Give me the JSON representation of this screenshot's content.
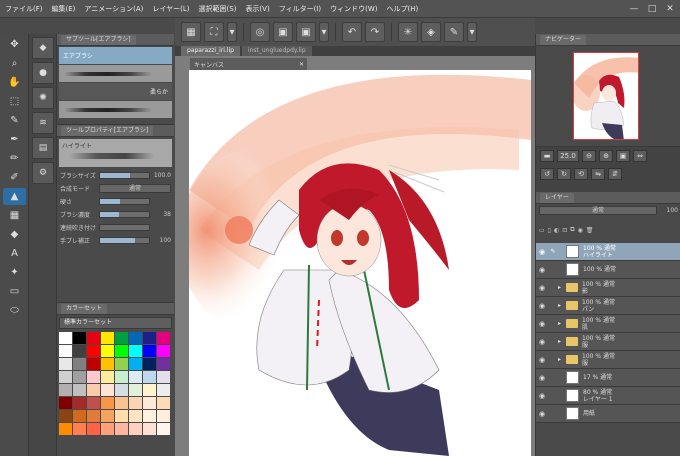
{
  "menu": [
    "ファイル(F)",
    "編集(E)",
    "アニメーション(A)",
    "レイヤー(L)",
    "選択範囲(S)",
    "表示(V)",
    "フィルター(I)",
    "ウィンドウ(W)",
    "ヘルプ(H)"
  ],
  "window_controls": [
    "—",
    "□",
    "✕"
  ],
  "command_bar": [
    "▦",
    "⛶",
    "▾",
    "◎",
    "▣",
    "▣",
    "▾",
    "↶",
    "↷",
    "✳",
    "◈",
    "✎",
    "▾"
  ],
  "doc_tabs": [
    "paparazzi_iri.lip",
    "inst_ungluedpdy.lip"
  ],
  "canvas_window_title": "キャンバス",
  "tools": [
    "✥",
    "⌕",
    "✋",
    "⬚",
    "✎",
    "✒",
    "✏",
    "✐",
    "▲",
    "▦",
    "◆",
    "A",
    "✦",
    "▭",
    "⬭"
  ],
  "sub_tools_panel": {
    "title": "サブツール[エアブラシ]",
    "brushes": [
      "エアブラシ",
      "柔らか"
    ]
  },
  "tool_property": {
    "title": "ツールプロパティ[エアブラシ]",
    "preview_label": "ハイライト",
    "rows": [
      {
        "label": "ブラシサイズ",
        "value": "100.0",
        "fill": 0.62
      },
      {
        "label": "合成モード",
        "select": "通常"
      },
      {
        "label": "硬さ",
        "value": "",
        "fill": 0.4
      },
      {
        "label": "ブラシ濃度",
        "value": "38",
        "fill": 0.38
      },
      {
        "label": "連続吹き付け",
        "value": "",
        "fill": 0
      },
      {
        "label": "手ブレ補正",
        "value": "100",
        "fill": 0.72
      }
    ]
  },
  "color_set": {
    "title": "カラーセット",
    "selected": "標準カラーセット",
    "swatches": [
      "#ffffff",
      "#000000",
      "#e60012",
      "#ffe600",
      "#00a040",
      "#0068b7",
      "#1d2088",
      "#e4007f",
      "#fafafa",
      "#404040",
      "#ff0000",
      "#ffff00",
      "#00ff00",
      "#00ffff",
      "#0000ff",
      "#ff00ff",
      "#e8e8e8",
      "#808080",
      "#c00000",
      "#ffc000",
      "#92d050",
      "#00b0f0",
      "#002060",
      "#7030a0",
      "#d0d0d0",
      "#a0a0a0",
      "#ffc7ce",
      "#ffeb9c",
      "#c6efce",
      "#ddebf7",
      "#bdd7ee",
      "#e4dfec",
      "#b0b0b0",
      "#c0c0c0",
      "#f8cbad",
      "#fce4d6",
      "#d6dce4",
      "#e2efda",
      "#fff2cc",
      "#ededed",
      "#800000",
      "#a52a2a",
      "#c0504d",
      "#f79646",
      "#fac090",
      "#fcd5b4",
      "#fde9d9",
      "#ffdab9",
      "#8b4513",
      "#d2691e",
      "#e07b39",
      "#f4a460",
      "#ffdead",
      "#ffe4c4",
      "#fff0e0",
      "#ffeedd",
      "#ff8c00",
      "#ff7f50",
      "#ff6347",
      "#ffa07a",
      "#ffb6a0",
      "#ffd0c0",
      "#ffe0d5",
      "#fff5ee"
    ]
  },
  "navigator": {
    "title": "ナビゲーター",
    "zoom": "25.0"
  },
  "layer_panel": {
    "title": "レイヤー",
    "blend": "通常",
    "opacity": "100",
    "layers": [
      {
        "pct": "100 % 通常",
        "name": "ハイライト",
        "type": "raster",
        "selected": true
      },
      {
        "pct": "100 % 通常",
        "name": "",
        "type": "raster"
      },
      {
        "pct": "100 % 通常",
        "name": "影",
        "type": "folder"
      },
      {
        "pct": "100 % 通常",
        "name": "パン",
        "type": "folder"
      },
      {
        "pct": "100 % 通常",
        "name": "肌",
        "type": "folder"
      },
      {
        "pct": "100 % 通常",
        "name": "服",
        "type": "folder"
      },
      {
        "pct": "100 % 通常",
        "name": "服",
        "type": "folder"
      },
      {
        "pct": "17 % 通常",
        "name": "",
        "type": "raster"
      },
      {
        "pct": "80 % 通常",
        "name": "レイヤー 1",
        "type": "raster"
      },
      {
        "pct": "",
        "name": "用紙",
        "type": "paper"
      }
    ]
  }
}
